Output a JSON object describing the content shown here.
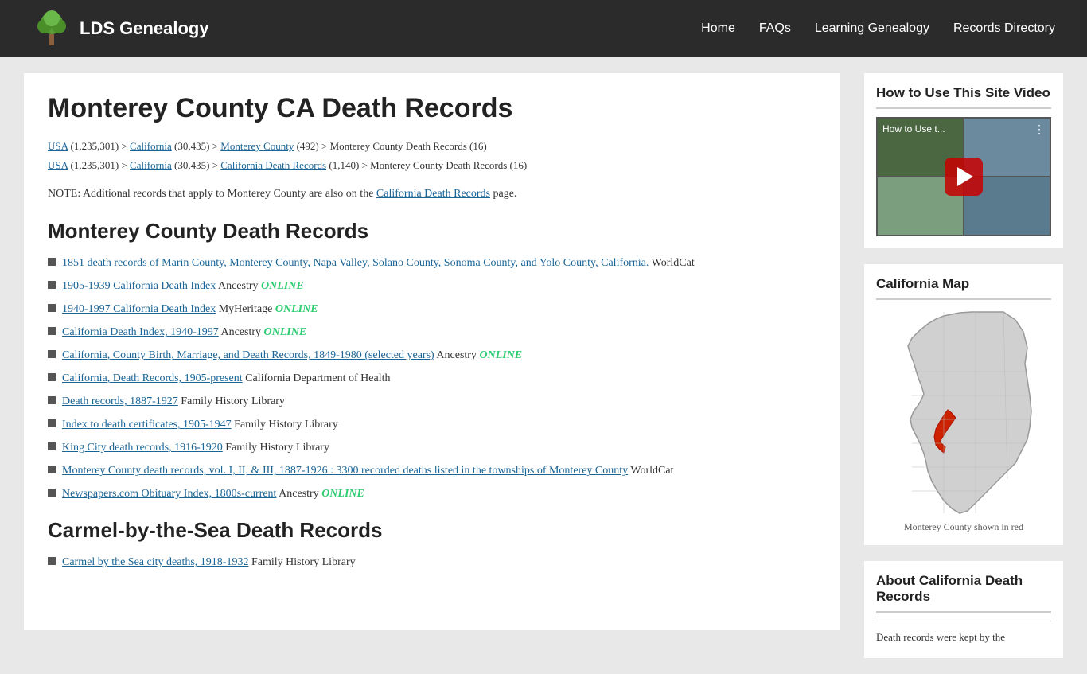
{
  "header": {
    "logo_text": "LDS Genealogy",
    "nav": {
      "home": "Home",
      "faqs": "FAQs",
      "learning_genealogy": "Learning Genealogy",
      "records_directory": "Records Directory"
    }
  },
  "page": {
    "title": "Monterey County CA Death Records",
    "breadcrumbs": [
      {
        "line": "USA (1,235,301) > California (30,435) > Monterey County (492) > Monterey County Death Records (16)"
      },
      {
        "line": "USA (1,235,301) > California (30,435) > California Death Records (1,140) > Monterey County Death Records (16)"
      }
    ],
    "note": "NOTE: Additional records that apply to Monterey County are also on the California Death Records page.",
    "sections": [
      {
        "id": "monterey-death",
        "title": "Monterey County Death Records",
        "records": [
          {
            "text": "1851 death records of Marin County, Monterey County, Napa Valley, Solano County, Sonoma County, and Yolo County, California.",
            "source": "WorldCat",
            "online": false
          },
          {
            "text": "1905-1939 California Death Index",
            "source": "Ancestry",
            "online": true
          },
          {
            "text": "1940-1997 California Death Index",
            "source": "MyHeritage",
            "online": true
          },
          {
            "text": "California Death Index, 1940-1997",
            "source": "Ancestry",
            "online": true
          },
          {
            "text": "California, County Birth, Marriage, and Death Records, 1849-1980 (selected years)",
            "source": "Ancestry",
            "online": true
          },
          {
            "text": "California, Death Records, 1905-present",
            "source": "California Department of Health",
            "online": false
          },
          {
            "text": "Death records, 1887-1927",
            "source": "Family History Library",
            "online": false
          },
          {
            "text": "Index to death certificates, 1905-1947",
            "source": "Family History Library",
            "online": false
          },
          {
            "text": "King City death records, 1916-1920",
            "source": "Family History Library",
            "online": false
          },
          {
            "text": "Monterey County death records, vol. I, II, & III, 1887-1926 : 3300 recorded deaths listed in the townships of Monterey County",
            "source": "WorldCat",
            "online": false
          },
          {
            "text": "Newspapers.com Obituary Index, 1800s-current",
            "source": "Ancestry",
            "online": true
          }
        ]
      },
      {
        "id": "carmel-death",
        "title": "Carmel-by-the-Sea Death Records",
        "records": [
          {
            "text": "Carmel by the Sea city deaths, 1918-1932",
            "source": "Family History Library",
            "online": false
          }
        ]
      }
    ]
  },
  "sidebar": {
    "video_section": {
      "title": "How to Use This Site Video",
      "video_overlay_title": "How to Use t..."
    },
    "map_section": {
      "title": "California Map",
      "caption": "Monterey County shown in red"
    },
    "about_section": {
      "title": "About California Death Records",
      "text": "Death records were kept by the"
    }
  },
  "online_label": "ONLINE"
}
